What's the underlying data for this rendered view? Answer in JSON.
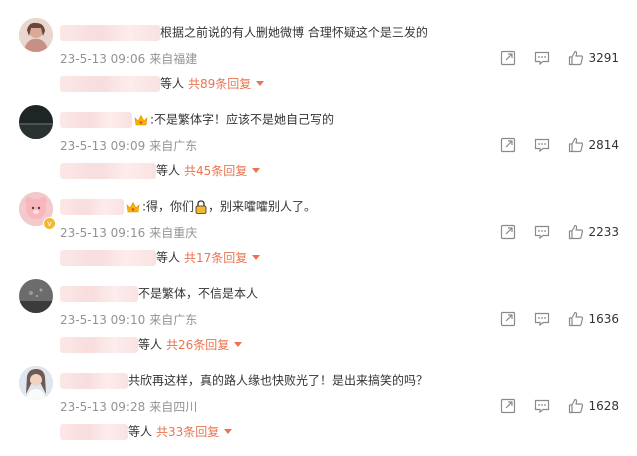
{
  "comments": [
    {
      "avatar": "avatar-girl-photo",
      "verified": false,
      "has_crown": false,
      "text": "根据之前说的有人删她微博 合理怀疑这个是三发的",
      "time": "23-5-13 09:06",
      "location": "来自福建",
      "likes": "3291",
      "reply_suffix": "等人",
      "reply_count": "共89条回复"
    },
    {
      "avatar": "avatar-dark-photo",
      "verified": false,
      "has_crown": true,
      "text": ":不是繁体字！应该不是她自己写的",
      "time": "23-5-13 09:09",
      "location": "来自广东",
      "likes": "2814",
      "reply_suffix": "等人",
      "reply_count": "共45条回复"
    },
    {
      "avatar": "avatar-pink-bear",
      "verified": true,
      "has_crown": true,
      "text_before_lock": ":得，你们",
      "text_after_lock": "，别来嚯嚯别人了。",
      "time": "23-5-13 09:16",
      "location": "来自重庆",
      "likes": "2233",
      "reply_suffix": "等人",
      "reply_count": "共17条回复"
    },
    {
      "avatar": "avatar-grey-photo",
      "verified": false,
      "has_crown": false,
      "text": "不是繁体，不信是本人",
      "time": "23-5-13 09:10",
      "location": "来自广东",
      "likes": "1636",
      "reply_suffix": "等人",
      "reply_count": "共26条回复"
    },
    {
      "avatar": "avatar-girl-selfie",
      "verified": false,
      "has_crown": false,
      "text": "共欣再这样，真的路人缘也快败光了！是出来搞笑的吗？",
      "time": "23-5-13 09:28",
      "location": "来自四川",
      "likes": "1628",
      "reply_suffix": "等人",
      "reply_count": "共33条回复"
    }
  ],
  "icons": {
    "share": "share-icon",
    "comment": "comment-icon",
    "like": "like-icon",
    "expand": "triangle-down-icon"
  },
  "colors": {
    "reply_link": "#eb7350",
    "meta_text": "#939393",
    "icon": "#8a8a8a"
  }
}
